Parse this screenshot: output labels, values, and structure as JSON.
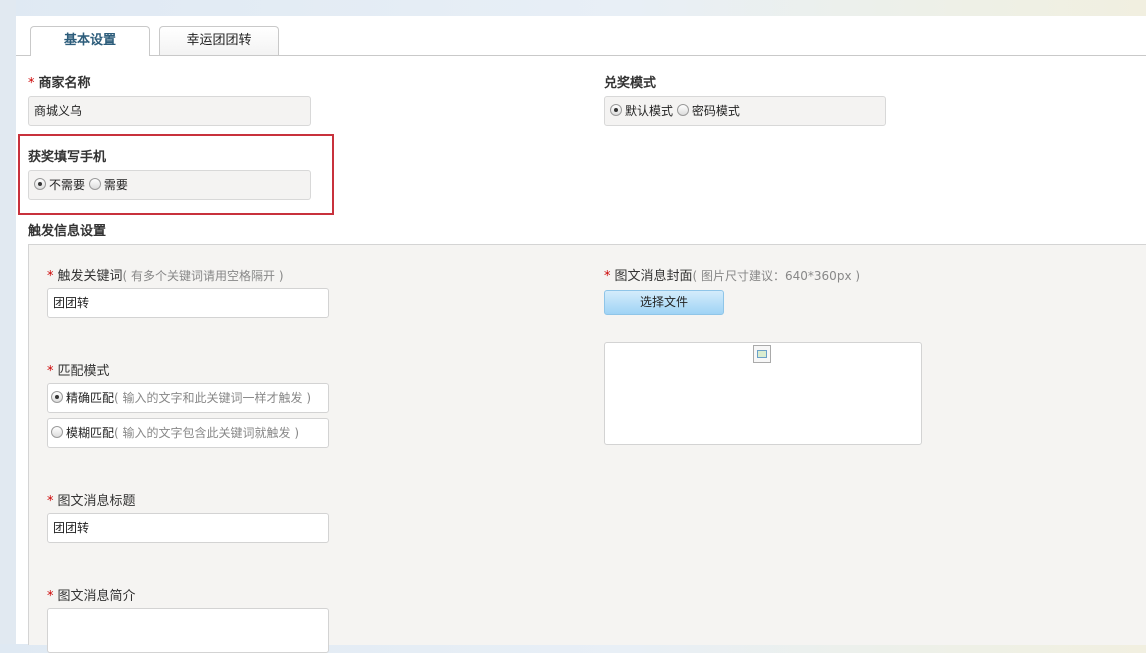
{
  "tabs": [
    {
      "label": "基本设置",
      "active": true
    },
    {
      "label": "幸运团团转",
      "active": false
    }
  ],
  "merchant": {
    "required_mark": "*",
    "label": "商家名称",
    "value": "商城义乌"
  },
  "redeem_mode": {
    "label": "兑奖模式",
    "options": [
      {
        "label": "默认模式",
        "selected": true
      },
      {
        "label": "密码模式",
        "selected": false
      }
    ]
  },
  "phone_required": {
    "label": "获奖填写手机",
    "options": [
      {
        "label": "不需要",
        "selected": true
      },
      {
        "label": "需要",
        "selected": false
      }
    ]
  },
  "trigger_section": {
    "title": "触发信息设置",
    "keyword": {
      "required_mark": "*",
      "label": "触发关键词",
      "hint": "( 有多个关键词请用空格隔开 )",
      "value": "团团转"
    },
    "match_mode": {
      "required_mark": "*",
      "label": "匹配模式",
      "options": [
        {
          "label": "精确匹配",
          "hint": "( 输入的文字和此关键词一样才触发 )",
          "selected": true
        },
        {
          "label": "模糊匹配",
          "hint": "( 输入的文字包含此关键词就触发 )",
          "selected": false
        }
      ]
    },
    "news_title": {
      "required_mark": "*",
      "label": "图文消息标题",
      "value": "团团转"
    },
    "news_summary": {
      "required_mark": "*",
      "label": "图文消息简介",
      "value": ""
    },
    "cover": {
      "required_mark": "*",
      "label": "图文消息封面",
      "hint": "( 图片尺寸建议：640*360px )",
      "button_label": "选择文件"
    }
  },
  "colors": {
    "accent_blue": "#9fd3f5",
    "required_red": "#cc0000",
    "highlight_red": "#c8313c",
    "active_tab_text": "#2d5d7b"
  }
}
